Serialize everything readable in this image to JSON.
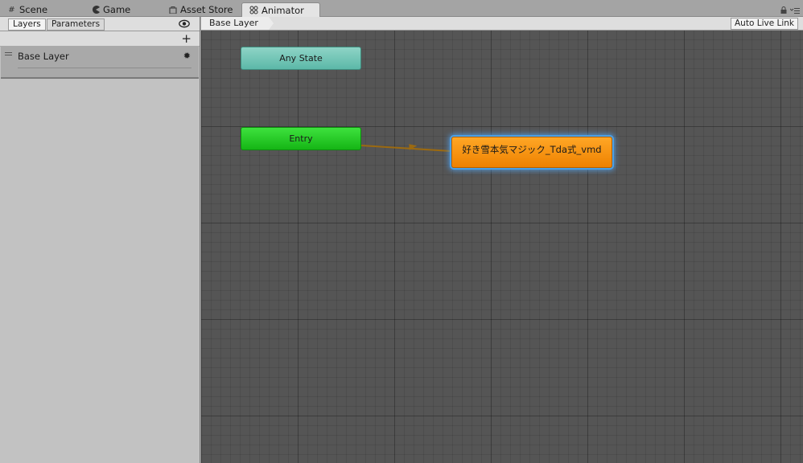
{
  "window_tabs": [
    {
      "label": "Scene",
      "icon": "grid-icon"
    },
    {
      "label": "Game",
      "icon": "pacman-icon"
    },
    {
      "label": "Asset Store",
      "icon": "shopping-bag-icon"
    },
    {
      "label": "Animator",
      "icon": "animator-icon",
      "active": true
    }
  ],
  "left_panel": {
    "tabs": [
      {
        "label": "Layers",
        "active": true
      },
      {
        "label": "Parameters"
      }
    ],
    "add_symbol": "+",
    "layers": [
      {
        "name": "Base Layer"
      }
    ]
  },
  "graph": {
    "breadcrumb": "Base Layer",
    "auto_live_link_label": "Auto Live Link",
    "nodes": {
      "any_state": "Any State",
      "entry": "Entry",
      "default_state": "好き雪本気マジック_Tda式_vmd"
    }
  },
  "colors": {
    "any_state": "#6bc4b5",
    "entry": "#2dcc2d",
    "default_state": "#f59210",
    "transition": "#9c6a10",
    "selection_glow": "#4aa0e6"
  }
}
